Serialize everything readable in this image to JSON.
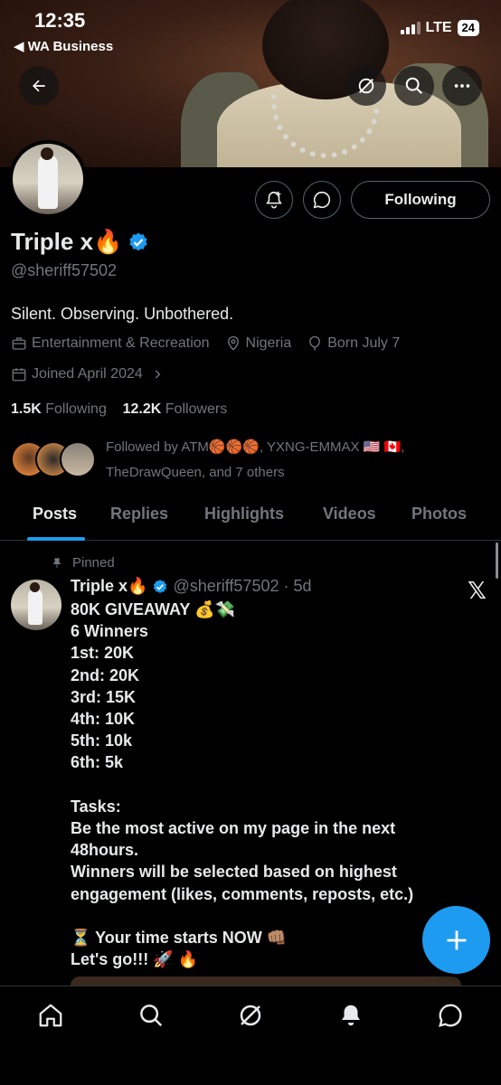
{
  "status_bar": {
    "time": "12:35",
    "back_app": "◀ WA Business",
    "network": "LTE",
    "battery": "24"
  },
  "profile": {
    "name": "Triple x🔥",
    "handle": "@sheriff57502",
    "bio": "Silent. Observing. Unbothered.",
    "category": "Entertainment & Recreation",
    "location": "Nigeria",
    "birthday": "Born July 7",
    "joined": "Joined April 2024",
    "following_count": "1.5K",
    "following_label": "Following",
    "followers_count": "12.2K",
    "followers_label": "Followers",
    "followed_by": "Followed by ATM🏀🏀🏀, YXNG-EMMAX 🇺🇸 🇨🇦, TheDrawQueen, and 7 others",
    "follow_button": "Following"
  },
  "tabs": [
    "Posts",
    "Replies",
    "Highlights",
    "Videos",
    "Photos"
  ],
  "pinned_post": {
    "pinned_label": "Pinned",
    "author": "Triple x🔥",
    "handle": "@sheriff57502",
    "age": "· 5d",
    "text": "80K GIVEAWAY 💰💸\n6 Winners\n1st: 20K\n2nd: 20K\n3rd: 15K\n4th: 10K\n5th: 10k\n6th: 5k\n\nTasks:\nBe the most active on my page in the next 48hours.\nWinners will be selected based on highest engagement (likes, comments, reposts, etc.)\n\n⏳ Your time starts NOW 👊🏽\nLet's go!!! 🚀 🔥"
  },
  "colors": {
    "accent": "#1d9bf0",
    "muted": "#71767b",
    "text": "#e7e9ea",
    "border": "#2f3336"
  },
  "icons": [
    "back-arrow-icon",
    "grok-icon",
    "search-icon",
    "more-icon",
    "notify-plus-icon",
    "message-icon",
    "verified-icon",
    "briefcase-icon",
    "location-icon",
    "balloon-icon",
    "calendar-icon",
    "pin-icon",
    "x-logo-icon",
    "plus-icon",
    "home-icon",
    "explore-icon",
    "grok-nav-icon",
    "bell-icon",
    "messages-nav-icon"
  ]
}
